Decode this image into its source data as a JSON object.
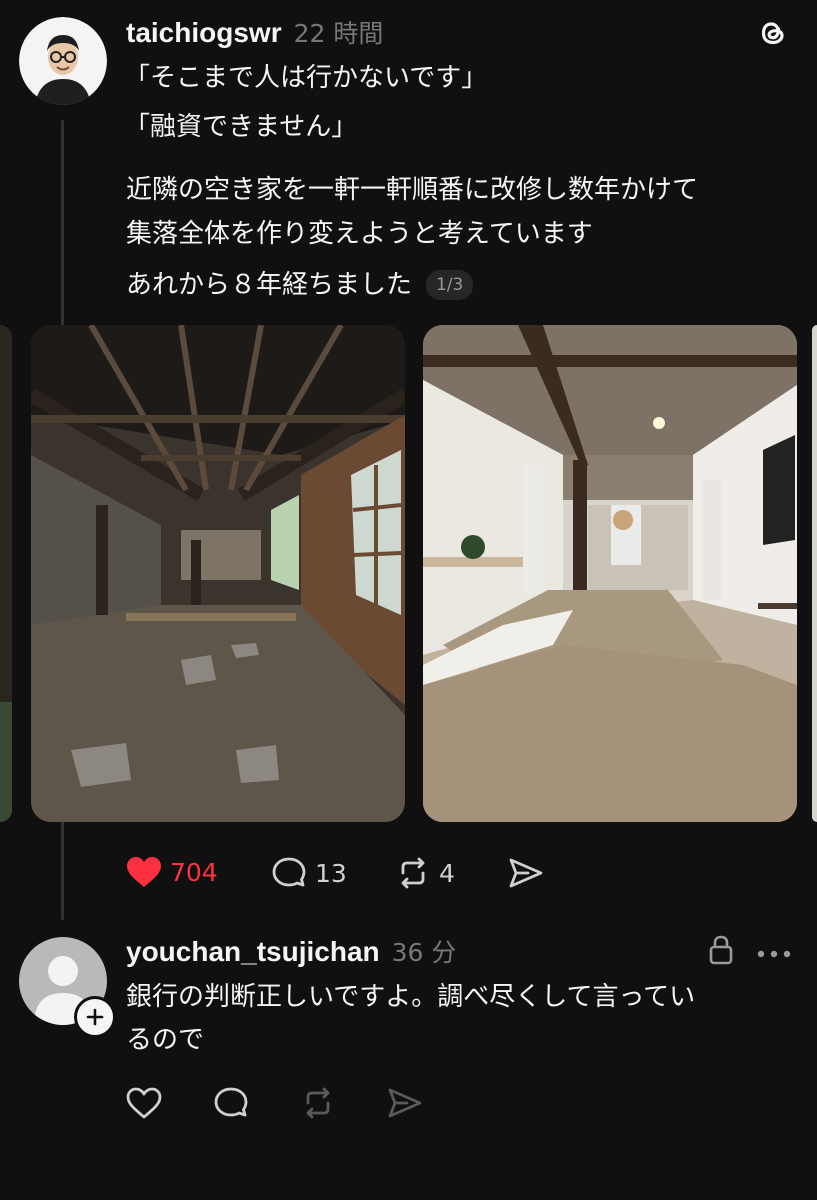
{
  "post": {
    "username": "taichiogswr",
    "time": "22 時間",
    "lines": [
      "「そこまで人は行かないです」",
      "「融資できません」",
      "近隣の空き家を一軒一軒順番に改修し数年かけて",
      "集落全体を作り変えようと考えています",
      "あれから８年経ちました"
    ],
    "carousel_counter": "1/3",
    "images": [
      {
        "icon": "renovation-before-photo"
      },
      {
        "icon": "renovated-bedroom-photo"
      }
    ],
    "actions": {
      "likes": "704",
      "replies": "13",
      "reposts": "4"
    },
    "colors": {
      "like": "#ff3040",
      "background": "#101010"
    }
  },
  "reply": {
    "username": "youchan_tsujichan",
    "time": "36 分",
    "lines": [
      "銀行の判断正しいですよ。調べ尽くして言ってい",
      "るので"
    ]
  }
}
